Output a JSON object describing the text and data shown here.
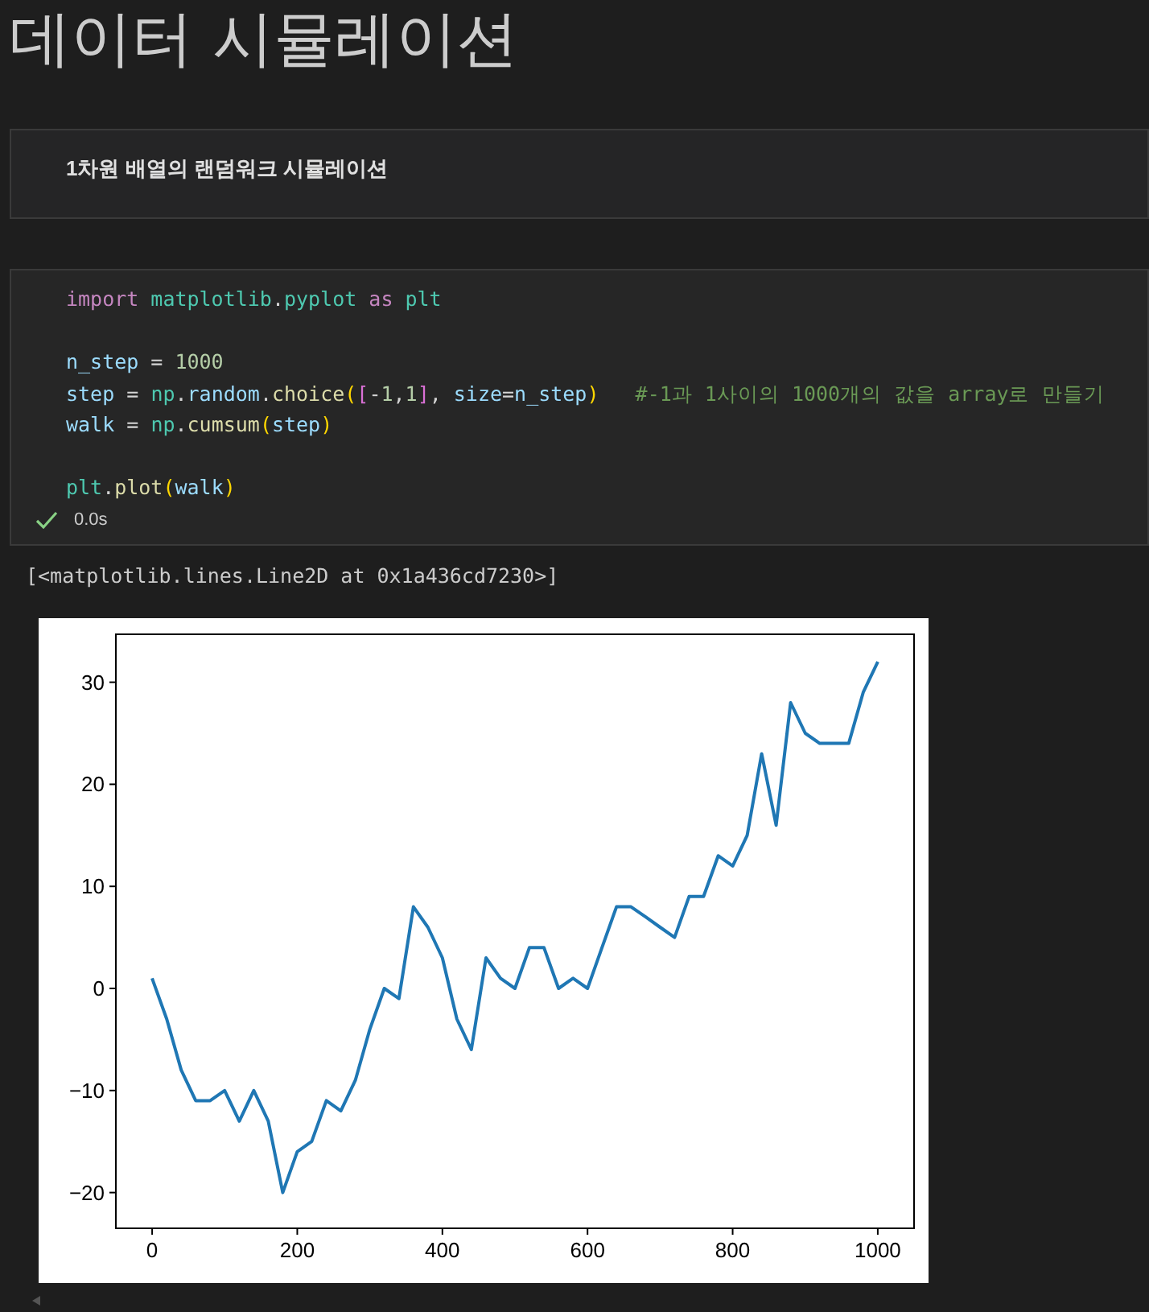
{
  "title": "데이터 시뮬레이션",
  "markdown_cell": {
    "text": "1차원 배열의 랜덤워크 시뮬레이션"
  },
  "code_cell": {
    "lines": [
      {
        "kind": "code",
        "tokens": [
          {
            "kind": "keyword",
            "text": "import"
          },
          {
            "kind": "module",
            "text": " matplotlib"
          },
          {
            "kind": "plain",
            "text": "."
          },
          {
            "kind": "module",
            "text": "pyplot"
          },
          {
            "kind": "keyword",
            "text": " as"
          },
          {
            "kind": "module",
            "text": " plt"
          }
        ]
      },
      {
        "kind": "blank"
      },
      {
        "kind": "code",
        "tokens": [
          {
            "kind": "variable",
            "text": "n_step"
          },
          {
            "kind": "plain",
            "text": " = "
          },
          {
            "kind": "number",
            "text": "1000"
          }
        ]
      },
      {
        "kind": "code",
        "tokens": [
          {
            "kind": "variable",
            "text": "step"
          },
          {
            "kind": "plain",
            "text": " = "
          },
          {
            "kind": "module",
            "text": "np"
          },
          {
            "kind": "plain",
            "text": "."
          },
          {
            "kind": "variable",
            "text": "random"
          },
          {
            "kind": "plain",
            "text": "."
          },
          {
            "kind": "function",
            "text": "choice"
          },
          {
            "kind": "bracket1",
            "text": "("
          },
          {
            "kind": "bracket2",
            "text": "["
          },
          {
            "kind": "plain",
            "text": "-"
          },
          {
            "kind": "number",
            "text": "1"
          },
          {
            "kind": "plain",
            "text": ","
          },
          {
            "kind": "number",
            "text": "1"
          },
          {
            "kind": "bracket2",
            "text": "]"
          },
          {
            "kind": "plain",
            "text": ", "
          },
          {
            "kind": "variable",
            "text": "size"
          },
          {
            "kind": "plain",
            "text": "="
          },
          {
            "kind": "variable",
            "text": "n_step"
          },
          {
            "kind": "bracket1",
            "text": ")"
          },
          {
            "kind": "comment",
            "text": "   #-1과 1사이의 1000개의 값을 array로 만들기"
          }
        ]
      },
      {
        "kind": "code",
        "tokens": [
          {
            "kind": "variable",
            "text": "walk"
          },
          {
            "kind": "plain",
            "text": " = "
          },
          {
            "kind": "module",
            "text": "np"
          },
          {
            "kind": "plain",
            "text": "."
          },
          {
            "kind": "function",
            "text": "cumsum"
          },
          {
            "kind": "bracket1",
            "text": "("
          },
          {
            "kind": "variable",
            "text": "step"
          },
          {
            "kind": "bracket1",
            "text": ")"
          }
        ]
      },
      {
        "kind": "blank"
      },
      {
        "kind": "code",
        "tokens": [
          {
            "kind": "module",
            "text": "plt"
          },
          {
            "kind": "plain",
            "text": "."
          },
          {
            "kind": "function",
            "text": "plot"
          },
          {
            "kind": "bracket1",
            "text": "("
          },
          {
            "kind": "variable",
            "text": "walk"
          },
          {
            "kind": "bracket1",
            "text": ")"
          }
        ]
      }
    ],
    "status": {
      "succeeded": true,
      "duration": "0.0s"
    }
  },
  "output": {
    "text": "[<matplotlib.lines.Line2D at 0x1a436cd7230>]",
    "chart_data": {
      "type": "line",
      "xlim": [
        -50,
        1050
      ],
      "ylim": [
        -23.5,
        34.7
      ],
      "xticks": [
        0,
        200,
        400,
        600,
        800,
        1000
      ],
      "yticks": [
        {
          "value": -20,
          "label": "−20"
        },
        {
          "value": -10,
          "label": "−10"
        },
        0,
        10,
        20,
        30
      ],
      "x": [
        0,
        20,
        40,
        60,
        80,
        100,
        120,
        140,
        160,
        180,
        200,
        220,
        240,
        260,
        280,
        300,
        320,
        340,
        360,
        380,
        400,
        420,
        440,
        460,
        480,
        500,
        520,
        540,
        560,
        580,
        600,
        620,
        640,
        660,
        680,
        700,
        720,
        740,
        760,
        780,
        800,
        820,
        840,
        860,
        880,
        900,
        920,
        940,
        960,
        980,
        1000
      ],
      "series": [
        {
          "color": "#1f77b4",
          "values": [
            1,
            -3,
            -8,
            -11,
            -11,
            -10,
            -13,
            -10,
            -13,
            -20,
            -16,
            -15,
            -11,
            -12,
            -9,
            -4,
            0,
            -1,
            8,
            6,
            3,
            -3,
            -6,
            3,
            1,
            0,
            4,
            4,
            0,
            1,
            0,
            4,
            8,
            8,
            7,
            6,
            5,
            9,
            9,
            13,
            12,
            15,
            23,
            16,
            28,
            25,
            24,
            24,
            24,
            29,
            32
          ]
        }
      ]
    }
  }
}
